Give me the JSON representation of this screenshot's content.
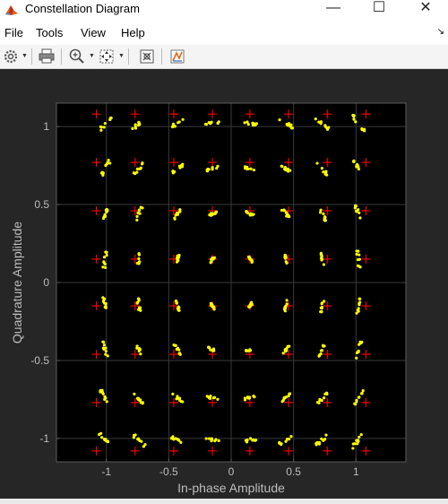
{
  "window": {
    "title": "Constellation Diagram",
    "controls": {
      "minimize": "—",
      "maximize": "☐",
      "close": "✕"
    },
    "icon": "matlab-icon"
  },
  "menu": {
    "items": [
      "File",
      "Tools",
      "View",
      "Help"
    ],
    "dock_arrow": "↘"
  },
  "toolbar": {
    "buttons": [
      "settings-icon",
      "print-icon",
      "zoom-in-icon",
      "fit-to-view-icon",
      "scale-axes-icon",
      "measurements-icon"
    ]
  },
  "chart_data": {
    "type": "scatter",
    "title": "",
    "xlabel": "In-phase Amplitude",
    "ylabel": "Quadrature Amplitude",
    "xlim": [
      -1.4,
      1.4
    ],
    "ylim": [
      -1.15,
      1.15
    ],
    "xticks": [
      -1,
      -0.5,
      0,
      0.5,
      1
    ],
    "xtick_labels": [
      "-1",
      "-0.5",
      "0",
      "0.5",
      "1"
    ],
    "yticks": [
      -1,
      -0.5,
      0,
      0.5,
      1
    ],
    "ytick_labels": [
      "-1",
      "-0.5",
      "0",
      "0.5",
      "1"
    ],
    "grid": true,
    "reference_levels": [
      -1.08,
      -0.77,
      -0.46,
      -0.15,
      0.15,
      0.46,
      0.77,
      1.08
    ],
    "received_levels": [
      -1.01,
      -0.74,
      -0.43,
      -0.15,
      0.15,
      0.44,
      0.73,
      1.02
    ],
    "colors": {
      "figure_bg": "#262626",
      "axes_bg": "#000000",
      "grid": "#3a3a3a",
      "axes_border": "#5a5a5a",
      "tick_text": "#bdbdbd",
      "label_text": "#bdbdbd",
      "received": "#ffff00",
      "reference": "#ff0000"
    }
  }
}
